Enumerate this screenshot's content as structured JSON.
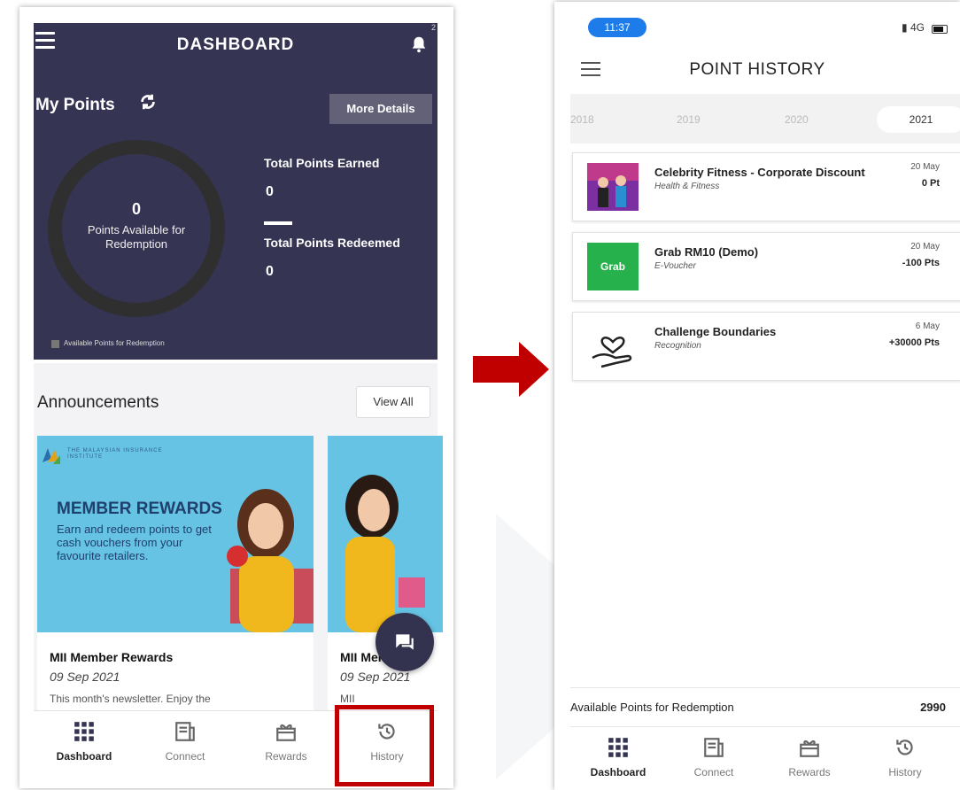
{
  "left_screen": {
    "header": {
      "title": "DASHBOARD",
      "badge": "2"
    },
    "points": {
      "heading": "My Points",
      "more_details": "More Details",
      "available_value": "0",
      "available_label": "Points Available for Redemption",
      "earned_label": "Total Points Earned",
      "earned_value": "0",
      "redeemed_label": "Total Points Redeemed",
      "redeemed_value": "0",
      "legend": "Available Points for Redemption"
    },
    "announcements": {
      "heading": "Announcements",
      "view_all": "View All",
      "cards": [
        {
          "org": "THE MALAYSIAN INSURANCE INSTITUTE",
          "banner_heading": "MEMBER REWARDS",
          "banner_sub": "Earn and redeem points to get cash vouchers from your favourite retailers.",
          "title": "MII Member Rewards",
          "date": "09 Sep 2021",
          "desc": "This month's newsletter. Enjoy the"
        },
        {
          "title": "MII Member P",
          "date": "09 Sep 2021",
          "desc": "MII"
        }
      ]
    },
    "tabs": [
      {
        "label": "Dashboard",
        "icon": "grid-icon"
      },
      {
        "label": "Connect",
        "icon": "news-icon"
      },
      {
        "label": "Rewards",
        "icon": "gift-icon"
      },
      {
        "label": "History",
        "icon": "history-icon"
      }
    ]
  },
  "right_screen": {
    "status_time": "11:37",
    "status_network": "4G",
    "title": "POINT HISTORY",
    "years": [
      "2018",
      "2019",
      "2020",
      "2021"
    ],
    "history": [
      {
        "name": "Celebrity Fitness - Corporate Discount",
        "category": "Health & Fitness",
        "date": "20 May",
        "points": "0 Pt",
        "thumb": "fitness-thumb"
      },
      {
        "name": "Grab RM10 (Demo)",
        "category": "E-Voucher",
        "date": "20 May",
        "points": "-100 Pts",
        "thumb": "Grab"
      },
      {
        "name": "Challenge Boundaries",
        "category": "Recognition",
        "date": "6 May",
        "points": "+30000 Pts",
        "thumb": "heart-hand-icon"
      }
    ],
    "available_label": "Available Points for Redemption",
    "available_value": "2990",
    "tabs": [
      {
        "label": "Dashboard",
        "icon": "grid-icon"
      },
      {
        "label": "Connect",
        "icon": "news-icon"
      },
      {
        "label": "Rewards",
        "icon": "gift-icon"
      },
      {
        "label": "History",
        "icon": "history-icon"
      }
    ]
  },
  "colors": {
    "dashboard_bg": "#353453",
    "highlight": "#c00000",
    "arrow": "#c00000",
    "grab_green": "#27b14c",
    "time_pill": "#1e7bea"
  }
}
